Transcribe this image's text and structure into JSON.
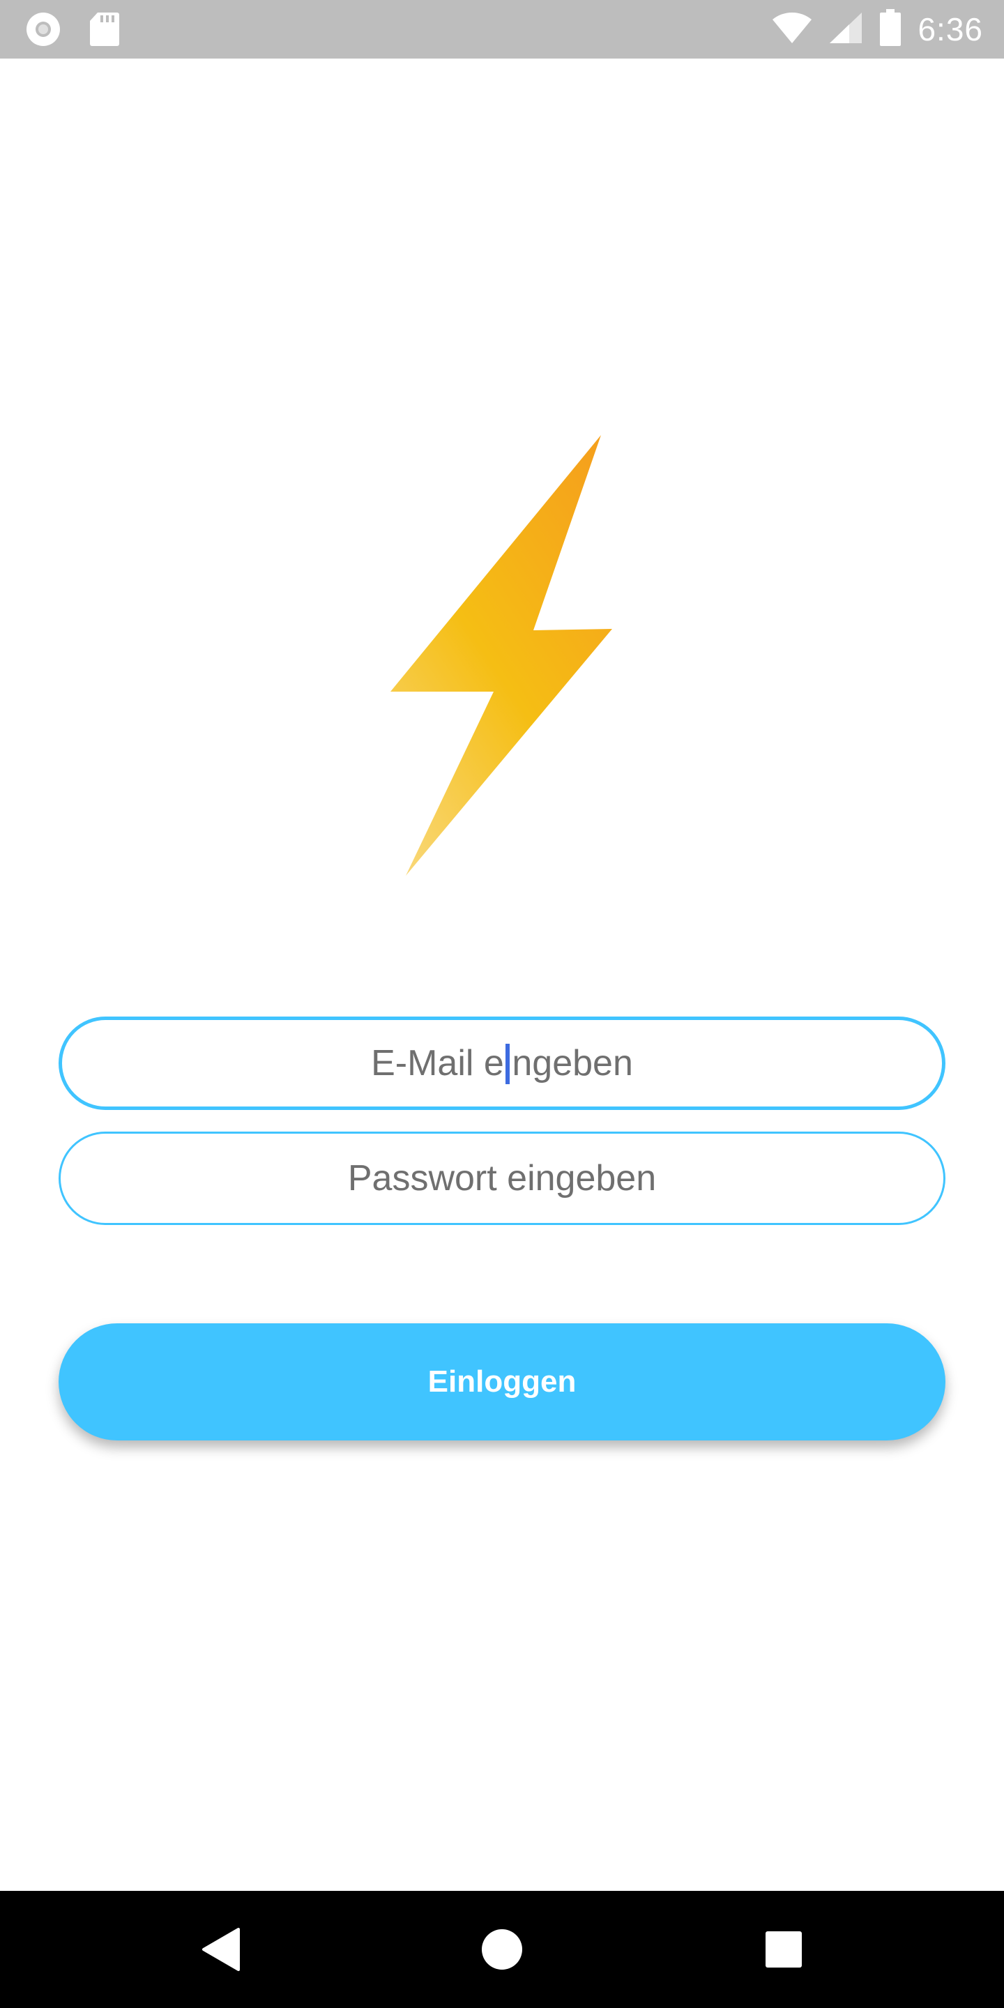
{
  "status_bar": {
    "time": "6:36",
    "icons": [
      "record-icon",
      "sd-card-icon",
      "wifi-icon",
      "signal-icon",
      "battery-icon"
    ]
  },
  "app": {
    "logo_icon": "lightning-bolt-icon",
    "email_field": {
      "placeholder": "E-Mail eingeben",
      "value": ""
    },
    "password_field": {
      "placeholder": "Passwort eingeben",
      "value": ""
    },
    "login_button": {
      "label": "Einloggen"
    }
  },
  "nav_bar": {
    "icons": [
      "back-icon",
      "home-icon",
      "recents-icon"
    ]
  },
  "colors": {
    "accent": "#40c4ff",
    "status_bar": "#bdbdbd",
    "nav_bar": "#000000",
    "bolt_top": "#f5a11c",
    "bolt_mid": "#f5be14",
    "bolt_bottom": "#f9d776",
    "caret": "#3d6be0"
  }
}
